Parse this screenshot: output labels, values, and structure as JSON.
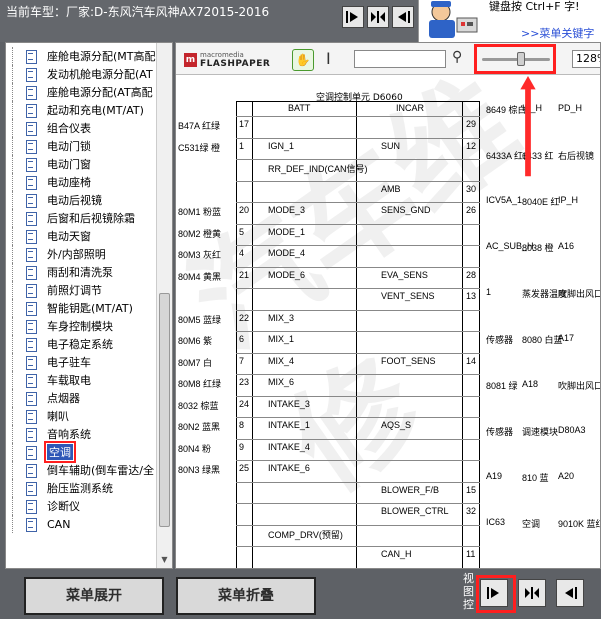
{
  "header": {
    "car_title": "当前车型：厂家:D-东风汽车风神AX72015-2016"
  },
  "hint": {
    "text": "键盘按 Ctrl+F 字!",
    "link": ">>菜单关键字"
  },
  "sidebar": {
    "items": [
      {
        "label": "座舱电源分配(MT高配"
      },
      {
        "label": "发动机舱电源分配(AT"
      },
      {
        "label": "座舱电源分配(AT高配"
      },
      {
        "label": "起动和充电(MT/AT)"
      },
      {
        "label": "组合仪表"
      },
      {
        "label": "电动门锁"
      },
      {
        "label": "电动门窗"
      },
      {
        "label": "电动座椅"
      },
      {
        "label": "电动后视镜"
      },
      {
        "label": "后窗和后视镜除霜"
      },
      {
        "label": "电动天窗"
      },
      {
        "label": "外/内部照明"
      },
      {
        "label": "雨刮和清洗泵"
      },
      {
        "label": "前照灯调节"
      },
      {
        "label": "智能钥匙(MT/AT)"
      },
      {
        "label": "车身控制模块"
      },
      {
        "label": "电子稳定系统"
      },
      {
        "label": "电子驻车"
      },
      {
        "label": "车载取电"
      },
      {
        "label": "点烟器"
      },
      {
        "label": "喇叭"
      },
      {
        "label": "音响系统"
      },
      {
        "label": "空调"
      },
      {
        "label": "倒车辅助(倒车雷达/全"
      },
      {
        "label": "胎压监测系统"
      },
      {
        "label": "诊断仪"
      },
      {
        "label": "CAN"
      }
    ],
    "selected_index": 22
  },
  "viewer": {
    "logo_small": "macromedia",
    "logo_big": "FLASHPAPER",
    "zoom_value": "128%",
    "zoom_level_fraction": 0.55,
    "diagram": {
      "title": "空调控制单元 D6060",
      "header_left": "BATT",
      "header_right": "INCAR",
      "rows": [
        {
          "pin": "17",
          "left": "",
          "right": "",
          "rpin": "29",
          "wire": "B47A 红绿"
        },
        {
          "pin": "1",
          "left": "IGN_1",
          "right": "SUN",
          "rpin": "12",
          "wire": "C531绿 橙"
        },
        {
          "pin": "",
          "left": "RR_DEF_IND(CAN信号)",
          "right": "",
          "rpin": "",
          "wire": ""
        },
        {
          "pin": "",
          "left": "",
          "right": "AMB",
          "rpin": "30",
          "wire": ""
        },
        {
          "pin": "20",
          "left": "MODE_3",
          "right": "SENS_GND",
          "rpin": "26",
          "wire": "80M1 粉蓝"
        },
        {
          "pin": "5",
          "left": "MODE_1",
          "right": "",
          "rpin": "",
          "wire": "80M2 橙黄"
        },
        {
          "pin": "4",
          "left": "MODE_4",
          "right": "",
          "rpin": "",
          "wire": "80M3 灰红"
        },
        {
          "pin": "21",
          "left": "MODE_6",
          "right": "EVA_SENS",
          "rpin": "28",
          "wire": "80M4 黄黑"
        },
        {
          "pin": "",
          "left": "",
          "right": "VENT_SENS",
          "rpin": "13",
          "wire": ""
        },
        {
          "pin": "22",
          "left": "MIX_3",
          "right": "",
          "rpin": "",
          "wire": "80M5 蓝绿"
        },
        {
          "pin": "6",
          "left": "MIX_1",
          "right": "",
          "rpin": "",
          "wire": "80M6 紫"
        },
        {
          "pin": "7",
          "left": "MIX_4",
          "right": "FOOT_SENS",
          "rpin": "14",
          "wire": "80M7 白"
        },
        {
          "pin": "23",
          "left": "MIX_6",
          "right": "",
          "rpin": "",
          "wire": "80M8 红绿"
        },
        {
          "pin": "24",
          "left": "INTAKE_3",
          "right": "",
          "rpin": "",
          "wire": "8032 棕蓝"
        },
        {
          "pin": "8",
          "left": "INTAKE_1",
          "right": "AQS_S",
          "rpin": "",
          "wire": "80N2 蓝黑"
        },
        {
          "pin": "9",
          "left": "INTAKE_4",
          "right": "",
          "rpin": "",
          "wire": "80N4 粉"
        },
        {
          "pin": "25",
          "left": "INTAKE_6",
          "right": "",
          "rpin": "",
          "wire": "80N3 绿黑"
        },
        {
          "pin": "",
          "left": "",
          "right": "BLOWER_F/B",
          "rpin": "15",
          "wire": ""
        },
        {
          "pin": "",
          "left": "",
          "right": "BLOWER_CTRL",
          "rpin": "32",
          "wire": ""
        },
        {
          "pin": "",
          "left": "COMP_DRV(预留)",
          "right": "",
          "rpin": "",
          "wire": ""
        },
        {
          "pin": "",
          "left": "",
          "right": "CAN_H",
          "rpin": "11",
          "wire": ""
        }
      ],
      "right_labels": [
        "8649 棕白",
        "IP_H",
        "PD_H",
        "6433A 红白",
        "6433 红",
        "右后视镜",
        "ICV5A_1",
        "8040E 红",
        "IP_H",
        "AC_SUB_H",
        "8038 橙",
        "A16",
        "1",
        "蒸发器温度",
        "吹脚出风口",
        "传感器",
        "8080 白蓝",
        "A17",
        "8081 绿",
        "A18",
        "吹脚出风口",
        "传感器",
        "调速模块",
        "D80A3",
        "A19",
        "810 蓝",
        "A20",
        "IC63",
        "空调",
        "9010K 蓝红"
      ]
    }
  },
  "bottom": {
    "expand_label": "菜单展开",
    "collapse_label": "菜单折叠",
    "view_label": "视图控"
  }
}
